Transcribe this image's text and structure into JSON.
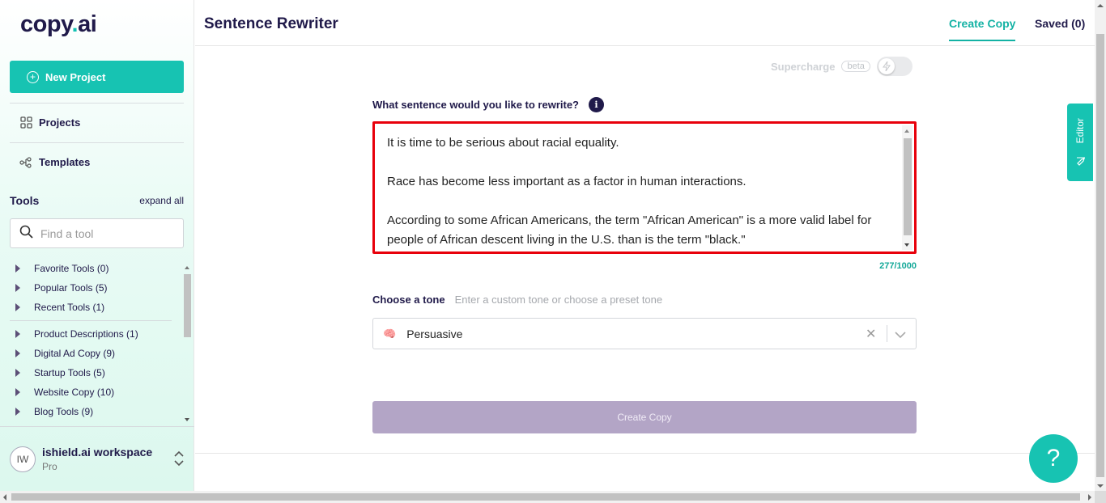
{
  "app": {
    "logo_text": "copy",
    "logo_dot": ".",
    "logo_suffix": "ai"
  },
  "sidebar": {
    "new_project_label": "New Project",
    "nav": [
      {
        "label": "Projects",
        "icon": "grid-icon"
      },
      {
        "label": "Templates",
        "icon": "templates-icon"
      }
    ],
    "tools_title": "Tools",
    "expand_all": "expand all",
    "search_placeholder": "Find a tool",
    "tool_groups": [
      "Favorite Tools (0)",
      "Popular Tools (5)",
      "Recent Tools (1)",
      "Product Descriptions (1)",
      "Digital Ad Copy (9)",
      "Startup Tools (5)",
      "Website Copy (10)",
      "Blog Tools (9)"
    ],
    "workspace": {
      "initials": "IW",
      "name": "ishield.ai workspace",
      "plan": "Pro"
    }
  },
  "header": {
    "title": "Sentence Rewriter",
    "tabs": {
      "create": "Create Copy",
      "saved": "Saved (0)"
    }
  },
  "main": {
    "supercharge": {
      "label": "Supercharge",
      "badge": "beta",
      "enabled": false
    },
    "question_label": "What sentence would you like to rewrite?",
    "info_icon": "i",
    "sentences": [
      "It is time to be serious about racial equality.",
      "Race has become less important as a factor in human interactions.",
      "According to some African Americans, the term \"African American\" is a more valid label for people of African descent living in the U.S. than is the term \"black.\""
    ],
    "char_count": "277/1000",
    "tone_label": "Choose a tone",
    "tone_hint": "Enter a custom tone or choose a preset tone",
    "tone_value": "Persuasive",
    "tone_emoji": "🧠",
    "create_button": "Create Copy"
  },
  "editor_tab_label": "Editor",
  "help_label": "?",
  "colors": {
    "accent": "#17c3b2",
    "brand_dark": "#201a4a",
    "highlight_border": "#e8000b",
    "button_disabled": "#b3a5c6"
  }
}
